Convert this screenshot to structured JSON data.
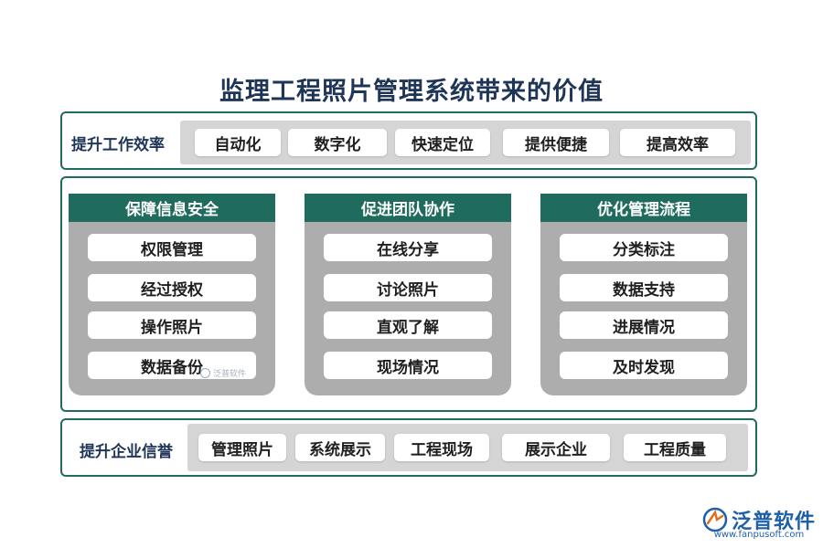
{
  "title": "监理工程照片管理系统带来的价值",
  "top_row": {
    "label": "提升工作效率",
    "items": [
      "自动化",
      "数字化",
      "快速定位",
      "提供便捷",
      "提高效率"
    ]
  },
  "columns": [
    {
      "header": "保障信息安全",
      "items": [
        "权限管理",
        "经过授权",
        "操作照片",
        "数据备份"
      ]
    },
    {
      "header": "促进团队协作",
      "items": [
        "在线分享",
        "讨论照片",
        "直观了解",
        "现场情况"
      ]
    },
    {
      "header": "优化管理流程",
      "items": [
        "分类标注",
        "数据支持",
        "进展情况",
        "及时发现"
      ]
    }
  ],
  "bottom_row": {
    "label": "提升企业信誉",
    "items": [
      "管理照片",
      "系统展示",
      "工程现场",
      "展示企业",
      "工程质量"
    ]
  },
  "watermark_small": "泛普软件",
  "logo": {
    "name": "泛普软件",
    "url": "www.fanpusoft.com"
  },
  "colors": {
    "accent": "#1f6b5e",
    "title": "#1e3557",
    "strip": "#d5d5d5",
    "column_bg": "#adadad",
    "logo": "#1e5fa8"
  }
}
